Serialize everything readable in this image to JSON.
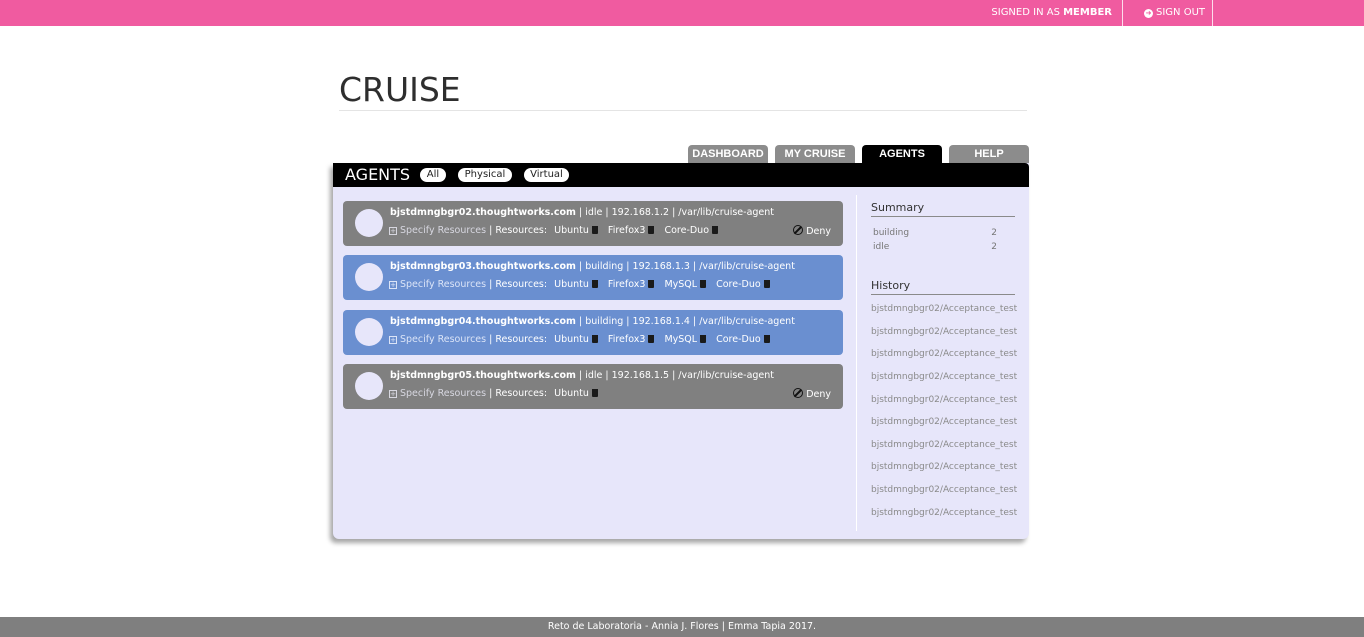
{
  "topbar": {
    "signed_prefix": "SIGNED IN AS",
    "user": "MEMBER",
    "signout_label": "SIGN OUT"
  },
  "logo": "CRUISE",
  "tabs": [
    {
      "label": "DASHBOARD",
      "active": false
    },
    {
      "label": "MY CRUISE",
      "active": false
    },
    {
      "label": "AGENTS",
      "active": true
    },
    {
      "label": "HELP",
      "active": false
    }
  ],
  "agents_panel": {
    "title": "AGENTS",
    "filters": [
      "All",
      "Physical",
      "Virtual"
    ]
  },
  "agents": [
    {
      "host": "bjstdmngbgr02.thoughtworks.com",
      "status": "idle",
      "ip": "192.168.1.2",
      "path": "/var/lib/cruise-agent",
      "specify": "Specify Resources",
      "resources_label": "Resources:",
      "resources": [
        "Ubuntu",
        "Firefox3",
        "Core-Duo"
      ],
      "deny": "Deny"
    },
    {
      "host": "bjstdmngbgr03.thoughtworks.com",
      "status": "building",
      "ip": "192.168.1.3",
      "path": "/var/lib/cruise-agent",
      "specify": "Specify Resources",
      "resources_label": "Resources:",
      "resources": [
        "Ubuntu",
        "Firefox3",
        "MySQL",
        "Core-Duo"
      ],
      "deny": ""
    },
    {
      "host": "bjstdmngbgr04.thoughtworks.com",
      "status": "building",
      "ip": "192.168.1.4",
      "path": "/var/lib/cruise-agent",
      "specify": "Specify Resources",
      "resources_label": "Resources:",
      "resources": [
        "Ubuntu",
        "Firefox3",
        "MySQL",
        "Core-Duo"
      ],
      "deny": ""
    },
    {
      "host": "bjstdmngbgr05.thoughtworks.com",
      "status": "idle",
      "ip": "192.168.1.5",
      "path": "/var/lib/cruise-agent",
      "specify": "Specify Resources",
      "resources_label": "Resources:",
      "resources": [
        "Ubuntu"
      ],
      "deny": "Deny"
    }
  ],
  "summary": {
    "title": "Summary",
    "rows": [
      {
        "label": "building",
        "value": "2"
      },
      {
        "label": "idle",
        "value": "2"
      }
    ]
  },
  "history": {
    "title": "History",
    "items": [
      "bjstdmngbgr02/Acceptance_test",
      "bjstdmngbgr02/Acceptance_test",
      "bjstdmngbgr02/Acceptance_test",
      "bjstdmngbgr02/Acceptance_test",
      "bjstdmngbgr02/Acceptance_test",
      "bjstdmngbgr02/Acceptance_test",
      "bjstdmngbgr02/Acceptance_test",
      "bjstdmngbgr02/Acceptance_test",
      "bjstdmngbgr02/Acceptance_test",
      "bjstdmngbgr02/Acceptance_test"
    ]
  },
  "footer": "Reto de Laboratoria - Annia J. Flores | Emma Tapia 2017.",
  "colors": {
    "topbar": "#f05ba0",
    "idle": "#808080",
    "building": "#6a8fd0",
    "panel": "#e7e6fa"
  }
}
